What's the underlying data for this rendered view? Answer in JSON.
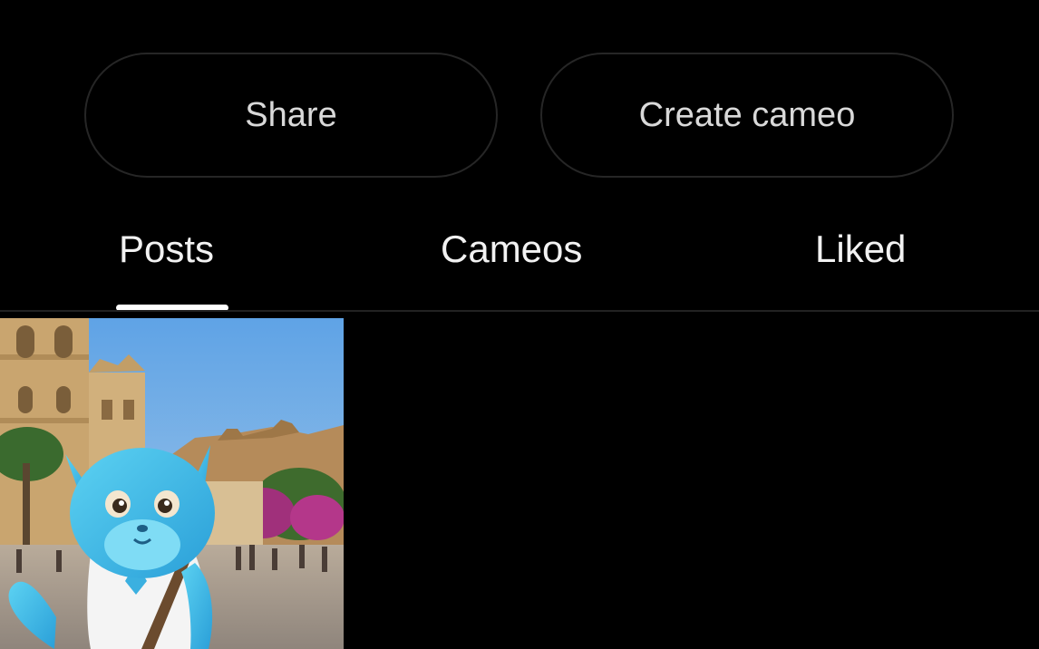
{
  "actions": {
    "share_label": "Share",
    "create_cameo_label": "Create cameo"
  },
  "tabs": [
    {
      "label": "Posts",
      "active": true
    },
    {
      "label": "Cameos",
      "active": false
    },
    {
      "label": "Liked",
      "active": false
    }
  ],
  "posts": [
    {
      "thumbnail": "blue-cat-character-in-town-square"
    }
  ],
  "colors": {
    "background": "#000000",
    "button_border": "#262626",
    "button_text": "#d9d9d9",
    "tab_text": "#f2f2f2",
    "tab_indicator": "#ffffff"
  }
}
